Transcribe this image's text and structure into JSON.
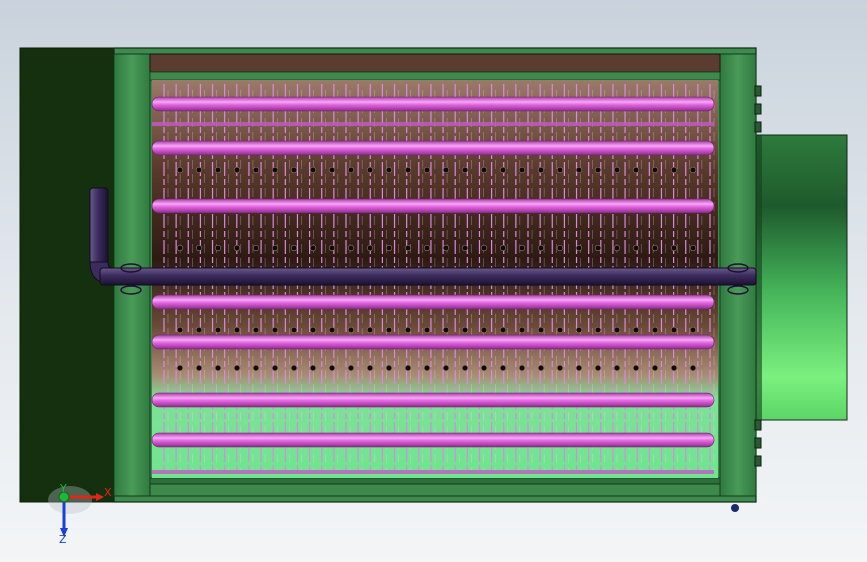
{
  "app": {
    "view": "cad-model-viewport"
  },
  "triad": {
    "x_label": "X",
    "y_label": "Y",
    "z_label": "Z",
    "x_color": "#e0261c",
    "y_color": "#1fb53a",
    "z_color": "#1b3fd6"
  },
  "colors": {
    "left_panel": "#14300f",
    "frame_green": "#3d8a4c",
    "frame_dark": "#1e4a26",
    "tube_pink": "#ea6ae8",
    "fin_pink": "#d98ae0",
    "manifold": "#3b2a5a",
    "core_bg_dark": "#3b2218",
    "core_bg_light": "#79e89a",
    "housing_green": "#2a7c3c"
  },
  "model": {
    "tube_rows": 9,
    "fin_count": 46
  }
}
